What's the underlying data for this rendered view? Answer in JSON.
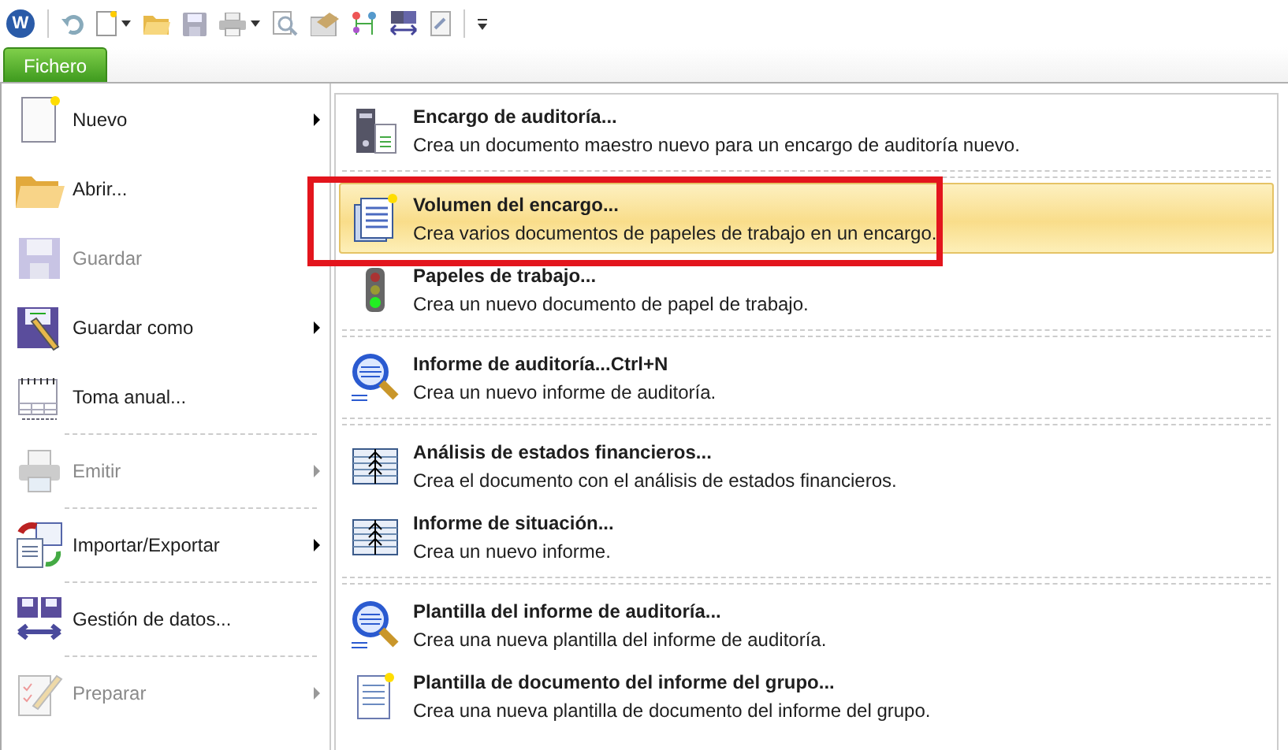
{
  "app_logo": "W",
  "file_tab": {
    "label": "Fichero",
    "selected": true
  },
  "left_menu": {
    "groups": [
      [
        {
          "label": "Nuevo",
          "disabled": false,
          "submenu": true
        },
        {
          "label": "Abrir...",
          "disabled": false,
          "submenu": false
        },
        {
          "label": "Guardar",
          "disabled": true,
          "submenu": false
        },
        {
          "label": "Guardar como",
          "disabled": false,
          "submenu": true
        },
        {
          "label": "Toma anual...",
          "disabled": false,
          "submenu": false
        }
      ],
      [
        {
          "label": "Emitir",
          "disabled": true,
          "submenu": true
        }
      ],
      [
        {
          "label": "Importar/Exportar",
          "disabled": false,
          "submenu": true
        }
      ],
      [
        {
          "label": "Gestión de datos...",
          "disabled": false,
          "submenu": false
        }
      ],
      [
        {
          "label": "Preparar",
          "disabled": true,
          "submenu": true
        }
      ]
    ]
  },
  "submenu": {
    "groups": [
      [
        {
          "title": "Encargo de auditoría...",
          "description": "Crea un documento maestro nuevo para un encargo de auditoría nuevo.",
          "selected": false,
          "callout": false
        }
      ],
      [
        {
          "title": "Volumen del encargo...",
          "description": "Crea varios documentos de papeles de trabajo en un encargo.",
          "selected": true,
          "callout": true
        },
        {
          "title": "Papeles de trabajo...",
          "description": "Crea un nuevo documento de papel de trabajo.",
          "selected": false,
          "callout": false
        }
      ],
      [
        {
          "title": "Informe de auditoría...Ctrl+N",
          "description": "Crea un nuevo informe de auditoría.",
          "selected": false,
          "callout": false
        }
      ],
      [
        {
          "title": "Análisis de estados financieros...",
          "description": "Crea el documento con el análisis de estados financieros.",
          "selected": false,
          "callout": false
        },
        {
          "title": "Informe de situación...",
          "description": "Crea un nuevo informe.",
          "selected": false,
          "callout": false
        }
      ],
      [
        {
          "title": "Plantilla del informe de auditoría...",
          "description": "Crea una nueva plantilla del informe de auditoría.",
          "selected": false,
          "callout": false
        },
        {
          "title": "Plantilla de documento del informe del grupo...",
          "description": "Crea una nueva plantilla de documento del informe del grupo.",
          "selected": false,
          "callout": false
        }
      ]
    ]
  }
}
